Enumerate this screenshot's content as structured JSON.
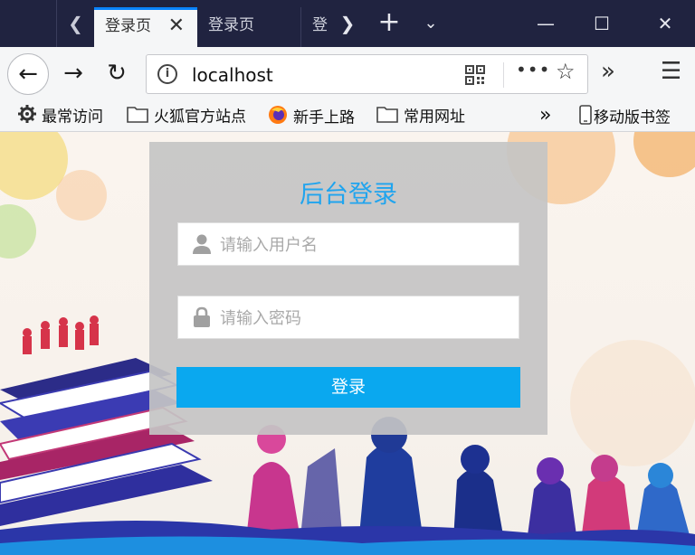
{
  "browser": {
    "tabs": [
      {
        "label": "登录页",
        "active": true
      },
      {
        "label": "登录页",
        "active": false
      },
      {
        "label": "登",
        "active": false
      }
    ],
    "url": "localhost",
    "window_controls": {
      "minimize": "—",
      "maximize": "☐",
      "close": "✕"
    }
  },
  "bookmarks": [
    {
      "label": "最常访问",
      "icon": "gear-icon"
    },
    {
      "label": "火狐官方站点",
      "icon": "folder-icon"
    },
    {
      "label": "新手上路",
      "icon": "firefox-icon"
    },
    {
      "label": "常用网址",
      "icon": "folder-icon"
    },
    {
      "label": "移动版书签",
      "icon": "mobile-icon"
    }
  ],
  "login": {
    "title": "后台登录",
    "username_placeholder": "请输入用户名",
    "password_placeholder": "请输入密码",
    "submit_label": "登录"
  },
  "colors": {
    "accent": "#20a4ee",
    "button": "#0aa8ef",
    "tab_strip": "#202340",
    "card": "#c4c4c4"
  }
}
